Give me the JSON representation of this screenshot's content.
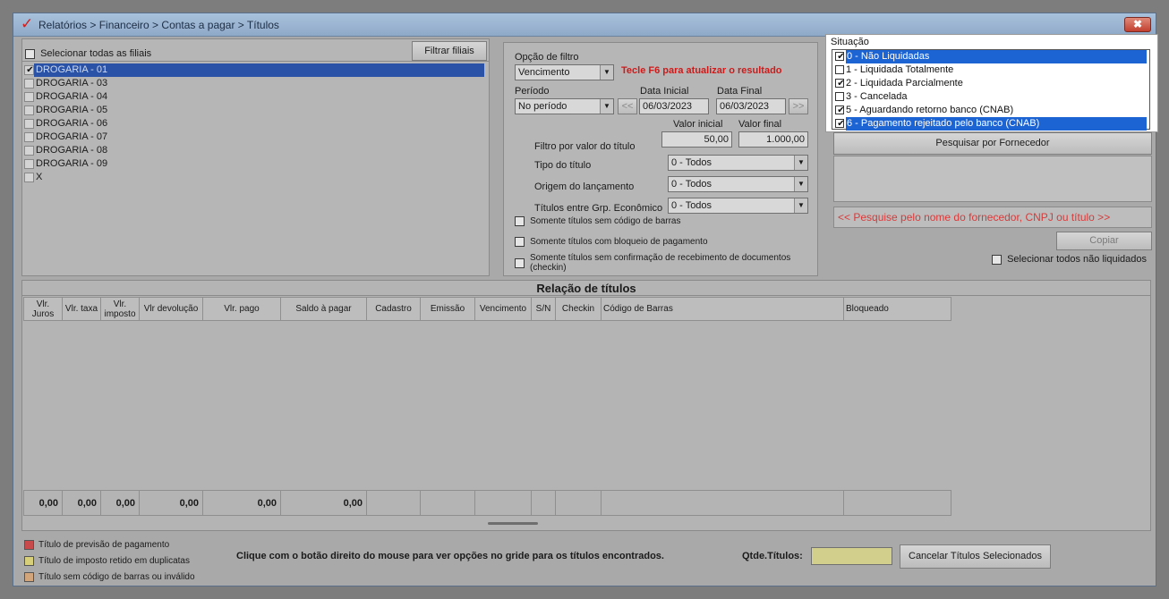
{
  "window": {
    "logo": "✓",
    "title": "Relatórios > Financeiro > Contas a pagar > Títulos",
    "close": "✖"
  },
  "filiais": {
    "select_all_label": "Selecionar todas as filiais",
    "filter_button": "Filtrar filiais",
    "items": [
      {
        "label": "DROGARIA - 01",
        "checked": true,
        "selected": true
      },
      {
        "label": "DROGARIA - 03",
        "checked": false,
        "selected": false
      },
      {
        "label": "DROGARIA - 04",
        "checked": false,
        "selected": false
      },
      {
        "label": "DROGARIA - 05",
        "checked": false,
        "selected": false
      },
      {
        "label": "DROGARIA - 06",
        "checked": false,
        "selected": false
      },
      {
        "label": "DROGARIA - 07",
        "checked": false,
        "selected": false
      },
      {
        "label": "DROGARIA - 08",
        "checked": false,
        "selected": false
      },
      {
        "label": "DROGARIA - 09",
        "checked": false,
        "selected": false
      },
      {
        "label": "X",
        "checked": false,
        "selected": false
      }
    ]
  },
  "filtro": {
    "opcao_label": "Opção de filtro",
    "opcao_value": "Vencimento",
    "f6_hint": "Tecle F6 para atualizar o resultado",
    "periodo_label": "Período",
    "periodo_value": "No período",
    "prev_btn": "<<",
    "next_btn": ">>",
    "data_inicial_label": "Data Inicial",
    "data_inicial_value": "06/03/2023",
    "data_final_label": "Data Final",
    "data_final_value": "06/03/2023",
    "valor_inicial_label": "Valor inicial",
    "valor_inicial_value": "50,00",
    "valor_final_label": "Valor final",
    "valor_final_value": "1.000,00",
    "filtro_valor_label": "Filtro por valor do título",
    "tipo_label": "Tipo do título",
    "tipo_value": "0 - Todos",
    "origem_label": "Origem do lançamento",
    "origem_value": "0 - Todos",
    "grp_label": "Títulos entre Grp. Econômico",
    "grp_value": "0 - Todos",
    "chk_codigo_barras": "Somente títulos sem código de barras",
    "chk_bloqueio": "Somente títulos com bloqueio de pagamento",
    "chk_confirmacao": "Somente títulos sem confirmação de recebimento de documentos (checkin)"
  },
  "situacao": {
    "label": "Situação",
    "items": [
      {
        "label": "0 - Não Liquidadas",
        "checked": true,
        "selected": true
      },
      {
        "label": "1 - Liquidada Totalmente",
        "checked": false,
        "selected": false
      },
      {
        "label": "2 - Liquidada Parcialmente",
        "checked": true,
        "selected": false
      },
      {
        "label": "3 - Cancelada",
        "checked": false,
        "selected": false
      },
      {
        "label": "5 - Aguardando retorno banco (CNAB)",
        "checked": true,
        "selected": false
      },
      {
        "label": "6 - Pagamento rejeitado pelo banco (CNAB)",
        "checked": true,
        "selected": true
      }
    ]
  },
  "fornecedor": {
    "search_button": "Pesquisar por Fornecedor",
    "hint": "<< Pesquise pelo nome do fornecedor, CNPJ ou título >>",
    "copy_button": "Copiar",
    "select_all_label": "Selecionar todos não liquidados"
  },
  "grid": {
    "title": "Relação de títulos",
    "columns": [
      "Vlr. Juros",
      "Vlr. taxa",
      "Vlr. imposto",
      "Vlr devolução",
      "Vlr. pago",
      "Saldo à pagar",
      "Cadastro",
      "Emissão",
      "Vencimento",
      "S/N",
      "Checkin",
      "Código de Barras",
      "Bloqueado"
    ],
    "totals": [
      "0,00",
      "0,00",
      "0,00",
      "0,00",
      "0,00",
      "0,00"
    ]
  },
  "legend": {
    "items": [
      {
        "label": "Título de previsão de pagamento",
        "color": "#c84a4a"
      },
      {
        "label": "Título de imposto retido em duplicatas",
        "color": "#d8cf7a"
      },
      {
        "label": "Título sem código de barras ou inválido",
        "color": "#d2a57a"
      }
    ]
  },
  "footer": {
    "hint": "Clique com o botão direito do mouse para ver opções no gride para os títulos encontrados.",
    "qtde_label": "Qtde.Títulos:",
    "qtde_value": "",
    "cancel_button": "Cancelar Títulos Selecionados"
  },
  "colors": {
    "accent_red": "#d01a1a",
    "selection_blue": "#1c63d3",
    "window_bg": "#a9a9a9"
  }
}
